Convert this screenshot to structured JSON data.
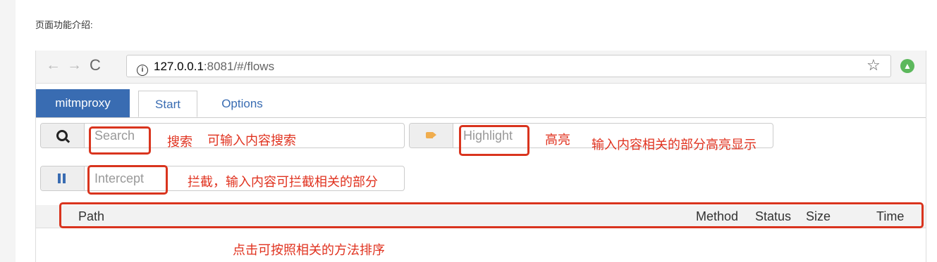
{
  "intro": "页面功能介绍:",
  "browser": {
    "url_host": "127.0.0.1",
    "url_rest": ":8081/#/flows",
    "info_glyph": "i",
    "back_glyph": "←",
    "forward_glyph": "→",
    "reload_glyph": "C",
    "star_glyph": "☆",
    "ext_glyph": "▲"
  },
  "app": {
    "brand": "mitmproxy",
    "tabs": [
      "Start",
      "Options"
    ],
    "search_placeholder": "Search",
    "highlight_placeholder": "Highlight",
    "intercept_placeholder": "Intercept",
    "columns": {
      "path": "Path",
      "method": "Method",
      "status": "Status",
      "size": "Size",
      "time": "Time"
    }
  },
  "annotations": {
    "search_1": "搜索",
    "search_2": "可输入内容搜索",
    "highlight_1": "高亮",
    "highlight_2": "输入内容相关的部分高亮显示",
    "intercept": "拦截，输入内容可拦截相关的部分",
    "sort": "点击可按照相关的方法排序"
  },
  "colors": {
    "brand": "#396cb2",
    "annotation": "#e0321f"
  },
  "icons": [
    "search-icon",
    "tag-icon",
    "pause-icon",
    "star-icon",
    "info-icon",
    "extension-icon"
  ]
}
